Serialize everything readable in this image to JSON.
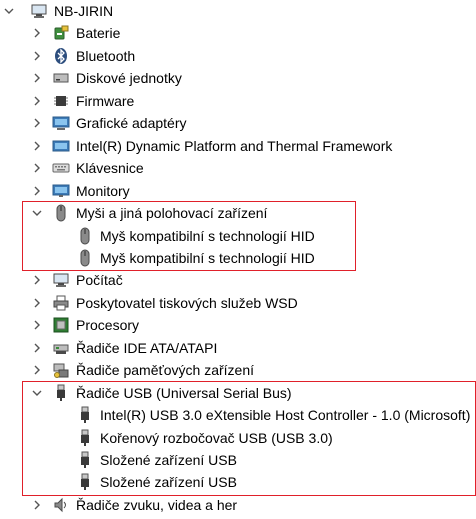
{
  "root": {
    "label": "NB-JIRIN",
    "icon": "computer-icon"
  },
  "categories": [
    {
      "label": "Baterie",
      "icon": "battery-icon",
      "expanded": false
    },
    {
      "label": "Bluetooth",
      "icon": "bluetooth-icon",
      "expanded": false
    },
    {
      "label": "Diskové jednotky",
      "icon": "disk-drive-icon",
      "expanded": false
    },
    {
      "label": "Firmware",
      "icon": "firmware-chip-icon",
      "expanded": false
    },
    {
      "label": "Grafické adaptéry",
      "icon": "display-adapter-icon",
      "expanded": false
    },
    {
      "label": "Intel(R) Dynamic Platform and Thermal Framework",
      "icon": "device-icon",
      "expanded": false
    },
    {
      "label": "Klávesnice",
      "icon": "keyboard-icon",
      "expanded": false
    },
    {
      "label": "Monitory",
      "icon": "monitor-icon",
      "expanded": false
    },
    {
      "label": "Myši a jiná polohovací zařízení",
      "icon": "mouse-icon",
      "expanded": true,
      "children": [
        {
          "label": "Myš kompatibilní s technologií HID",
          "icon": "mouse-icon"
        },
        {
          "label": "Myš kompatibilní s technologií HID",
          "icon": "mouse-icon"
        }
      ]
    },
    {
      "label": "Počítač",
      "icon": "computer-icon",
      "expanded": false
    },
    {
      "label": "Poskytovatel tiskových služeb WSD",
      "icon": "printer-icon",
      "expanded": false
    },
    {
      "label": "Procesory",
      "icon": "processor-icon",
      "expanded": false
    },
    {
      "label": "Řadiče IDE ATA/ATAPI",
      "icon": "ide-controller-icon",
      "expanded": false
    },
    {
      "label": "Řadiče paměťových zařízení",
      "icon": "storage-controller-icon",
      "expanded": false
    },
    {
      "label": "Řadiče USB (Universal Serial Bus)",
      "icon": "usb-icon",
      "expanded": true,
      "children": [
        {
          "label": "Intel(R) USB 3.0 eXtensible Host Controller - 1.0 (Microsoft)",
          "icon": "usb-icon"
        },
        {
          "label": "Kořenový rozbočovač USB (USB 3.0)",
          "icon": "usb-icon"
        },
        {
          "label": "Složené zařízení USB",
          "icon": "usb-icon"
        },
        {
          "label": "Složené zařízení USB",
          "icon": "usb-icon"
        }
      ]
    },
    {
      "label": "Řadiče zvuku, videa a her",
      "icon": "speaker-icon",
      "expanded": false
    }
  ],
  "colors": {
    "highlight": "#e0202a",
    "icon_blue": "#2b6fb3",
    "icon_gray": "#5a5a5a",
    "arrow": "#555555"
  }
}
